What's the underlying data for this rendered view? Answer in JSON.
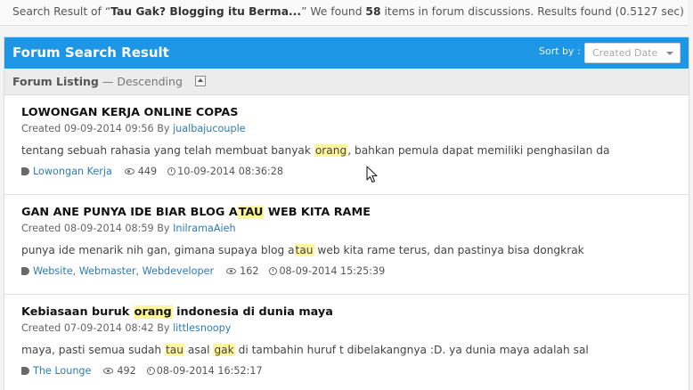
{
  "summary": {
    "prefix": "Search Result of “",
    "query": "Tau Gak? Blogging itu Berma...",
    "mid": "” We found ",
    "count": "58",
    "suffix": " items in forum discussions. Results found (0.5127 sec)"
  },
  "panel": {
    "title": "Forum Search Result",
    "sort_label": "Sort by :",
    "sort_value": "Created Date"
  },
  "listing": {
    "title": "Forum Listing",
    "dash": " — ",
    "order": "Descending"
  },
  "items": [
    {
      "title_pre": "LOWONGAN KERJA ONLINE COPAS",
      "title_hl": "",
      "title_post": "",
      "created": "Created 09-09-2014 09:56 By ",
      "author": "jualbajucouple",
      "snippet_pre": "tentang sebuah rahasia yang telah membuat banyak ",
      "snippet_hl1": "orang",
      "snippet_mid": ", bahkan pemula dapat memiliki penghasilan da",
      "snippet_hl2": "",
      "snippet_post": "",
      "tags": "Lowongan Kerja",
      "views": "449",
      "updated": "10-09-2014 08:36:28"
    },
    {
      "title_pre": "GAN ANE PUNYA IDE BIAR BLOG A",
      "title_hl": "TAU",
      "title_post": " WEB KITA RAME",
      "created": "Created 08-09-2014 08:59 By ",
      "author": "InilramaAieh",
      "snippet_pre": "punya ide menarik nih gan, gimana supaya blog a",
      "snippet_hl1": "tau",
      "snippet_mid": " web kita rame terus, dan pastinya bisa dongkrak",
      "snippet_hl2": "",
      "snippet_post": "",
      "tags": "Website, Webmaster, Webdeveloper",
      "views": "162",
      "updated": "08-09-2014 15:25:39"
    },
    {
      "title_pre": "Kebiasaan buruk ",
      "title_hl": "orang",
      "title_post": " indonesia di dunia maya",
      "created": "Created 07-09-2014 08:42 By ",
      "author": "littlesnoopy",
      "snippet_pre": "maya, pasti semua sudah ",
      "snippet_hl1": "tau",
      "snippet_mid": " asal ",
      "snippet_hl2": "gak",
      "snippet_post": " di tambahin huruf t dibelakangnya :D. ya dunia maya adalah sal",
      "tags": "The Lounge",
      "views": "492",
      "updated": "08-09-2014 16:52:17"
    }
  ],
  "icons": [
    "tag-icon",
    "eye-icon",
    "clock-icon",
    "caret-down-icon",
    "collapse-up-icon",
    "mouse-cursor-icon"
  ],
  "colors": {
    "header": "#1e96e6",
    "highlight": "#fff799",
    "link": "#2d7bb6"
  }
}
